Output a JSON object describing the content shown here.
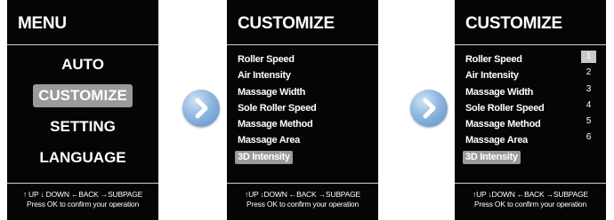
{
  "screen1": {
    "title": "MENU",
    "items": [
      {
        "label": "AUTO"
      },
      {
        "label": "CUSTOMIZE"
      },
      {
        "label": "SETTING"
      },
      {
        "label": "LANGUAGE"
      }
    ],
    "selected_index": 1,
    "footer_line1": "↑ UP ↓ DOWN ←BACK →SUBPAGE",
    "footer_line2": "Press OK to confirm your operation"
  },
  "screen2": {
    "title": "CUSTOMIZE",
    "items": [
      {
        "label": "Roller Speed"
      },
      {
        "label": "Air Intensity"
      },
      {
        "label": "Massage Width"
      },
      {
        "label": "Sole Roller Speed"
      },
      {
        "label": "Massage Method"
      },
      {
        "label": "Massage Area"
      },
      {
        "label": "3D Intensity"
      }
    ],
    "selected_index": 6,
    "footer_line1": "↑UP ↓DOWN ←BACK →SUBPAGE",
    "footer_line2": "Press OK to confirm your operation"
  },
  "screen3": {
    "title": "CUSTOMIZE",
    "items": [
      {
        "label": "Roller Speed",
        "value": "1"
      },
      {
        "label": "Air Intensity",
        "value": "2"
      },
      {
        "label": "Massage Width",
        "value": "3"
      },
      {
        "label": "Sole Roller Speed",
        "value": "4"
      },
      {
        "label": "Massage Method",
        "value": "5"
      },
      {
        "label": "Massage Area",
        "value": "6"
      },
      {
        "label": "3D Intensity",
        "value": ""
      }
    ],
    "selected_index": 6,
    "selected_value_index": 0,
    "footer_line1": "↑UP ↓DOWN ←BACK →SUBPAGE",
    "footer_line2": "Press OK to confirm your operation"
  },
  "arrows": [
    {
      "icon": "chevron-right-icon"
    },
    {
      "icon": "chevron-right-icon"
    }
  ],
  "colors": {
    "screen_bg": "#050505",
    "selection_bg": "#9a9a9a",
    "arrow_blue": "#6f9fd4"
  }
}
